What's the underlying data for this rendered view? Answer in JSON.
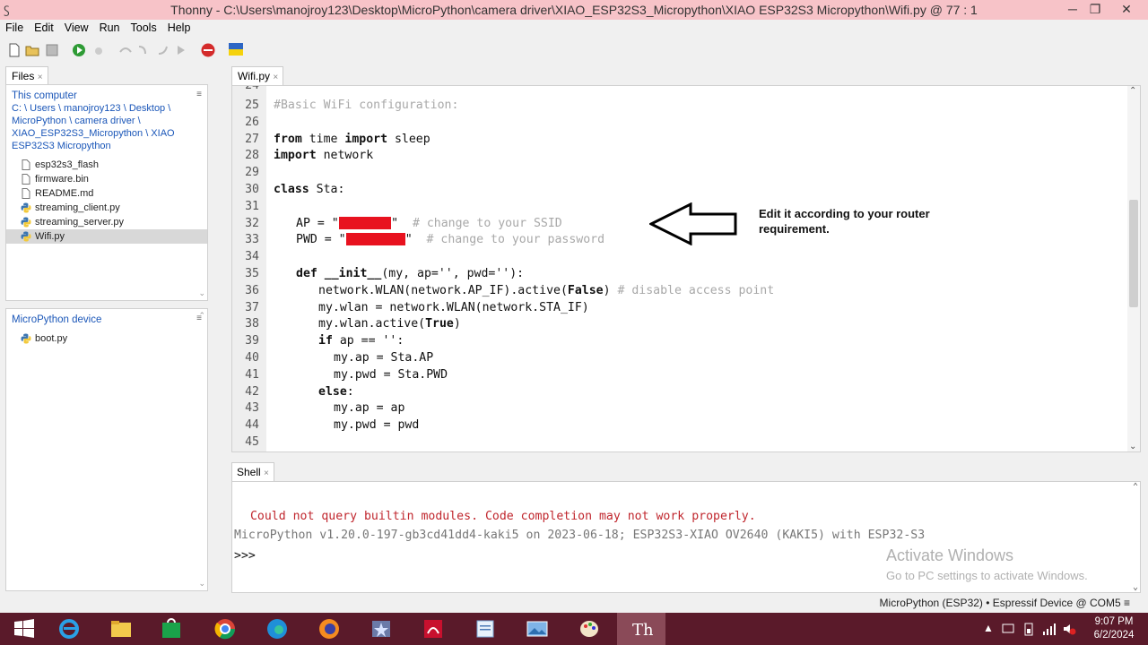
{
  "window": {
    "title": "Thonny  -  C:\\Users\\manojroy123\\Desktop\\MicroPython\\camera driver\\XIAO_ESP32S3_Micropython\\XIAO ESP32S3 Micropython\\Wifi.py  @  77 : 1",
    "app_icon": "thonny-icon",
    "minimize": "─",
    "restore": "❐",
    "close": "✕"
  },
  "menu": {
    "items": [
      "File",
      "Edit",
      "View",
      "Run",
      "Tools",
      "Help"
    ]
  },
  "toolbar": {
    "icons": [
      "new-file-icon",
      "open-file-icon",
      "save-icon",
      "run-icon",
      "debug-icon",
      "step-over-icon",
      "step-into-icon",
      "step-out-icon",
      "resume-icon",
      "stop-icon",
      "ukraine-flag-icon"
    ]
  },
  "files": {
    "tab_label": "Files",
    "tab_close": "×",
    "heading": "This computer",
    "path_lines": [
      "C: \\ Users \\ manojroy123 \\ Desktop \\",
      "MicroPython \\ camera driver \\",
      "XIAO_ESP32S3_Micropython \\ XIAO",
      "ESP32S3 Micropython"
    ],
    "items": [
      {
        "name": "esp32s3_flash",
        "icon": "file-icon"
      },
      {
        "name": "firmware.bin",
        "icon": "file-icon"
      },
      {
        "name": "README.md",
        "icon": "file-icon"
      },
      {
        "name": "streaming_client.py",
        "icon": "python-file-icon"
      },
      {
        "name": "streaming_server.py",
        "icon": "python-file-icon"
      },
      {
        "name": "Wifi.py",
        "icon": "python-file-icon",
        "selected": true
      }
    ]
  },
  "device": {
    "heading": "MicroPython device",
    "items": [
      {
        "name": "boot.py",
        "icon": "python-file-icon"
      }
    ]
  },
  "editor": {
    "tab_label": "Wifi.py",
    "tab_close": "×",
    "partial_line_number": "24",
    "lines": [
      {
        "n": "25",
        "indent": 0,
        "parts": [
          {
            "t": "#Basic WiFi configuration:",
            "c": "cm"
          }
        ]
      },
      {
        "n": "26",
        "indent": 0,
        "parts": []
      },
      {
        "n": "27",
        "indent": 0,
        "parts": [
          {
            "t": "from",
            "c": "kw"
          },
          {
            "t": " time "
          },
          {
            "t": "import",
            "c": "kw"
          },
          {
            "t": " sleep"
          }
        ]
      },
      {
        "n": "28",
        "indent": 0,
        "parts": [
          {
            "t": "import",
            "c": "kw"
          },
          {
            "t": " network"
          }
        ]
      },
      {
        "n": "29",
        "indent": 0,
        "parts": []
      },
      {
        "n": "30",
        "indent": 0,
        "parts": [
          {
            "t": "class",
            "c": "kw"
          },
          {
            "t": " Sta:"
          }
        ]
      },
      {
        "n": "31",
        "indent": 0,
        "parts": []
      },
      {
        "n": "32",
        "indent": 25,
        "parts": [
          {
            "t": "AP = \""
          },
          {
            "redact": 4.6
          },
          {
            "t": "\""
          },
          {
            "t": "  # change to your SSID",
            "c": "cm"
          }
        ]
      },
      {
        "n": "33",
        "indent": 25,
        "parts": [
          {
            "t": "PWD = \""
          },
          {
            "redact": 5.2
          },
          {
            "t": "\""
          },
          {
            "t": "  # change to your password",
            "c": "cm"
          }
        ]
      },
      {
        "n": "34",
        "indent": 0,
        "parts": []
      },
      {
        "n": "35",
        "indent": 25,
        "parts": [
          {
            "t": "def",
            "c": "kw"
          },
          {
            "t": " "
          },
          {
            "t": "__init__",
            "c": "kw"
          },
          {
            "t": "(my, ap='', pwd=''):"
          }
        ]
      },
      {
        "n": "36",
        "indent": 50,
        "parts": [
          {
            "t": "network.WLAN(network.AP_IF).active("
          },
          {
            "t": "False",
            "c": "kw"
          },
          {
            "t": ") "
          },
          {
            "t": "# disable access point",
            "c": "cm"
          }
        ]
      },
      {
        "n": "37",
        "indent": 50,
        "parts": [
          {
            "t": "my.wlan = network.WLAN(network.STA_IF)"
          }
        ]
      },
      {
        "n": "38",
        "indent": 50,
        "parts": [
          {
            "t": "my.wlan.active("
          },
          {
            "t": "True",
            "c": "kw"
          },
          {
            "t": ")"
          }
        ]
      },
      {
        "n": "39",
        "indent": 50,
        "parts": [
          {
            "t": "if",
            "c": "kw"
          },
          {
            "t": " ap == '':"
          }
        ]
      },
      {
        "n": "40",
        "indent": 67,
        "parts": [
          {
            "t": "my.ap = Sta.AP"
          }
        ]
      },
      {
        "n": "41",
        "indent": 67,
        "parts": [
          {
            "t": "my.pwd = Sta.PWD"
          }
        ]
      },
      {
        "n": "42",
        "indent": 50,
        "parts": [
          {
            "t": "else",
            "c": "kw"
          },
          {
            "t": ":"
          }
        ]
      },
      {
        "n": "43",
        "indent": 67,
        "parts": [
          {
            "t": "my.ap = ap"
          }
        ]
      },
      {
        "n": "44",
        "indent": 67,
        "parts": [
          {
            "t": "my.pwd = pwd"
          }
        ]
      },
      {
        "n": "45",
        "indent": 0,
        "parts": []
      }
    ],
    "annotation": "Edit it according to your router requirement.",
    "annotation_icon": "left-arrow-icon"
  },
  "shell": {
    "tab_label": "Shell",
    "tab_close": "×",
    "warning": " Could not query builtin modules. Code completion may not work properly.",
    "banner": "MicroPython v1.20.0-197-gb3cd41dd4-kaki5 on 2023-06-18; ESP32S3-XIAO OV2640 (KAKI5) with ESP32-S3",
    "prompt": ">>>",
    "warning_color": "#c0262d"
  },
  "watermark": {
    "line1": "Activate Windows",
    "line2": "Go to PC settings to activate Windows."
  },
  "statusbar": {
    "text": "MicroPython (ESP32)  •  Espressif Device @ COM5  ≡"
  },
  "taskbar": {
    "apps": [
      "windows-start-icon",
      "internet-explorer-icon",
      "file-explorer-icon",
      "store-icon",
      "chrome-icon",
      "edge-icon",
      "firefox-icon",
      "pinned-app-icon",
      "acrobat-icon",
      "notepad-icon",
      "photos-icon",
      "paint-icon",
      "thonny-icon"
    ],
    "active_index": 12,
    "tray_icons": [
      "tray-up-arrow-icon",
      "tray-network-icon",
      "tray-battery-icon",
      "tray-signal-icon",
      "tray-volume-icon"
    ],
    "time": "9:07 PM",
    "date": "6/2/2024"
  }
}
